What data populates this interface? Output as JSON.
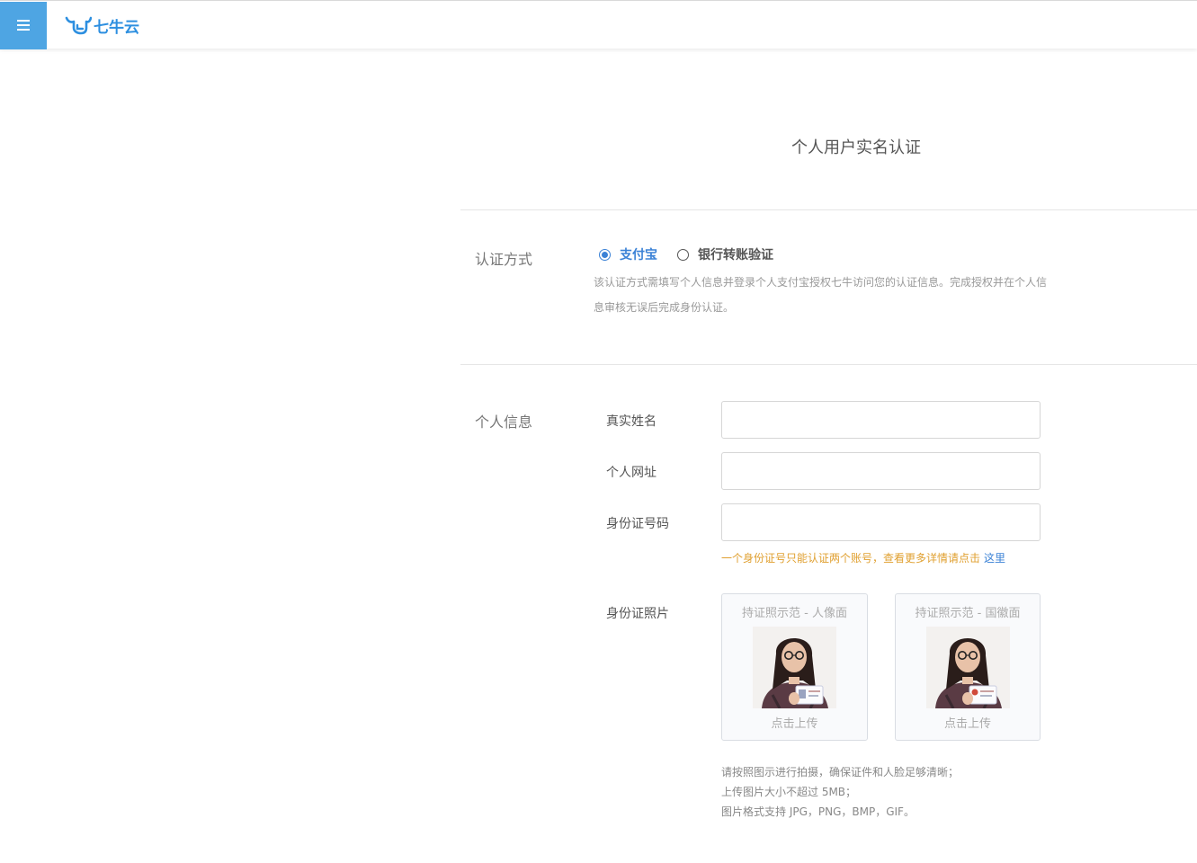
{
  "header": {
    "menu_icon": "hamburger-menu-icon",
    "logo_text": "七牛云",
    "logo_icon": "qiniu-bull-logo"
  },
  "page_title": "个人用户实名认证",
  "auth_method": {
    "section_label": "认证方式",
    "options": [
      {
        "label": "支付宝",
        "selected": true
      },
      {
        "label": "银行转账验证",
        "selected": false
      }
    ],
    "description": "该认证方式需填写个人信息并登录个人支付宝授权七牛访问您的认证信息。完成授权并在个人信息审核无误后完成身份认证。"
  },
  "personal_info": {
    "section_label": "个人信息",
    "fields": {
      "real_name": {
        "label": "真实姓名",
        "value": ""
      },
      "website": {
        "label": "个人网址",
        "value": ""
      },
      "id_number": {
        "label": "身份证号码",
        "value": ""
      }
    },
    "id_warning": "一个身份证号只能认证两个账号，查看更多详情请点击",
    "id_warning_link": "这里",
    "id_photo_label": "身份证照片",
    "upload_cards": [
      {
        "title": "持证照示范 - 人像面",
        "cta": "点击上传"
      },
      {
        "title": "持证照示范 - 国徽面",
        "cta": "点击上传"
      }
    ],
    "tips": [
      "请按照图示进行拍摄，确保证件和人脸足够清晰；",
      "上传图片大小不超过 5MB；",
      "图片格式支持 JPG，PNG，BMP，GIF。"
    ]
  },
  "colors": {
    "accent": "#3b82d6",
    "menu_bg": "#4ea5e3",
    "warning": "#e0a030"
  }
}
